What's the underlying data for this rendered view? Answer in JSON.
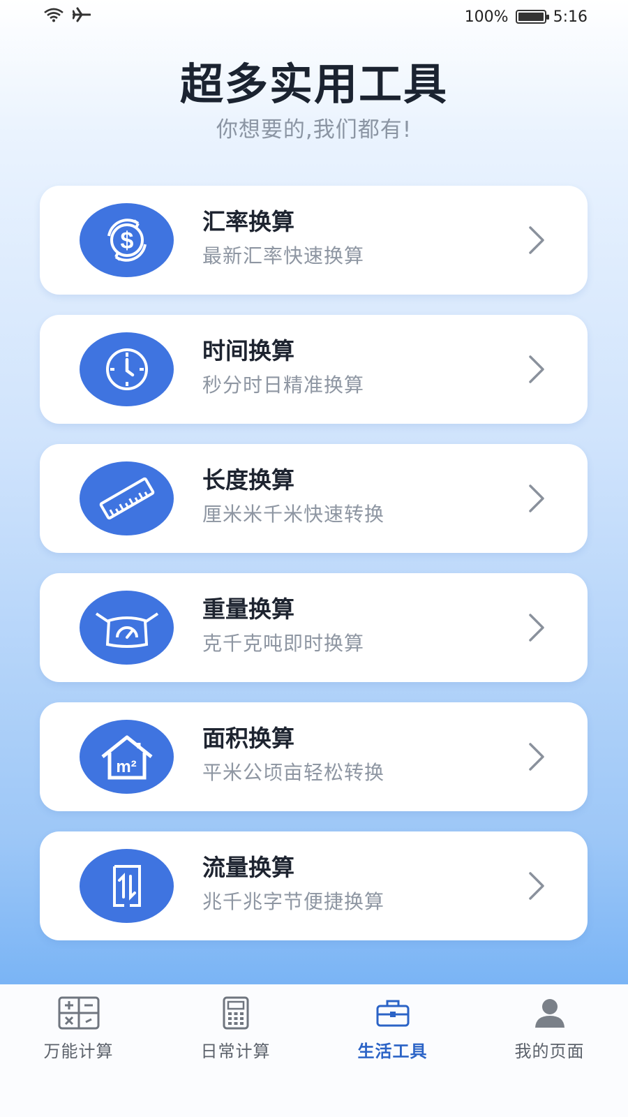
{
  "status_bar": {
    "battery": "100%",
    "time": "5:16",
    "icons": [
      "wifi-icon",
      "airplane-icon",
      "battery-icon"
    ]
  },
  "header": {
    "title": "超多实用工具",
    "subtitle": "你想要的,我们都有!"
  },
  "tools": [
    {
      "title": "汇率换算",
      "desc": "最新汇率快速换算",
      "icon": "currency-exchange-icon"
    },
    {
      "title": "时间换算",
      "desc": "秒分时日精准换算",
      "icon": "clock-icon"
    },
    {
      "title": "长度换算",
      "desc": "厘米米千米快速转换",
      "icon": "ruler-icon"
    },
    {
      "title": "重量换算",
      "desc": "克千克吨即时换算",
      "icon": "scale-icon"
    },
    {
      "title": "面积换算",
      "desc": "平米公顷亩轻松转换",
      "icon": "house-area-icon"
    },
    {
      "title": "流量换算",
      "desc": "兆千兆字节便捷换算",
      "icon": "data-transfer-icon"
    }
  ],
  "nav": {
    "items": [
      {
        "label": "万能计算",
        "icon": "calculator-grid-icon",
        "active": false
      },
      {
        "label": "日常计算",
        "icon": "calculator-icon",
        "active": false
      },
      {
        "label": "生活工具",
        "icon": "toolbox-icon",
        "active": true
      },
      {
        "label": "我的页面",
        "icon": "user-icon",
        "active": false
      }
    ]
  },
  "colors": {
    "accent": "#3f74e0",
    "nav_active": "#2b63c6",
    "title": "#1b2330",
    "muted": "#8e96a2"
  }
}
